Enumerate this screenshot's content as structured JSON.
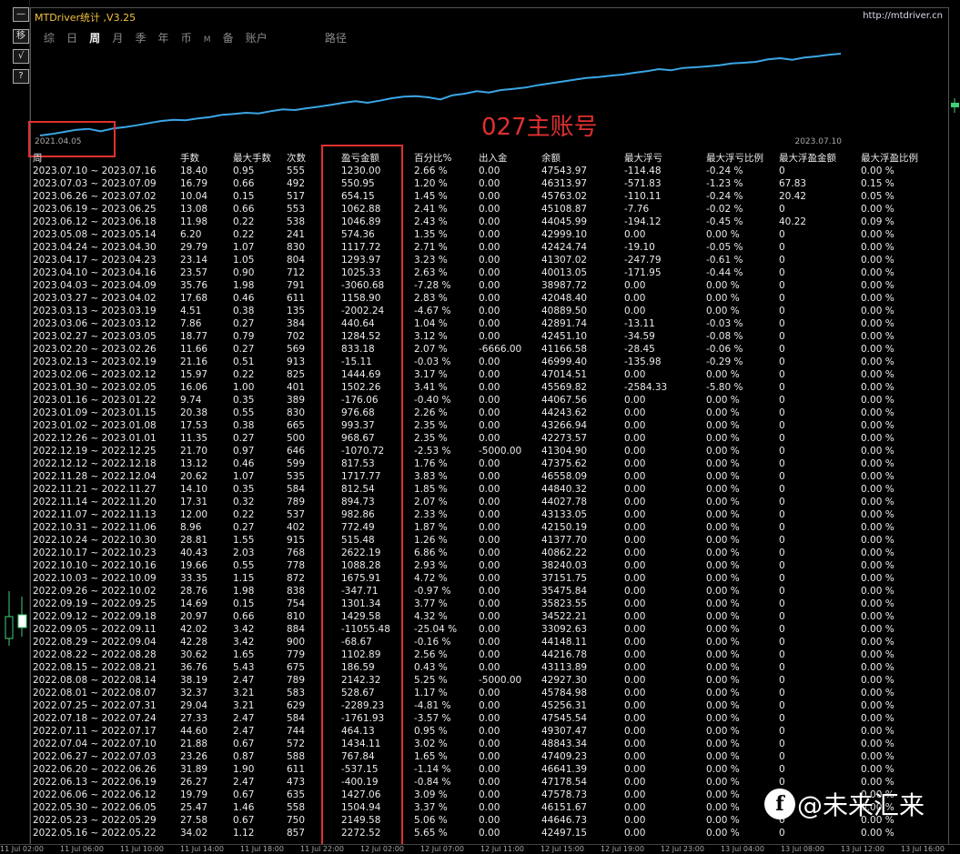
{
  "app": {
    "title": "MTDriver统计 ,V3.25",
    "site": "http://mtdriver.cn"
  },
  "toolbar": {
    "items": [
      {
        "icon": "minimize-icon",
        "label": "—"
      },
      {
        "icon": "copy-icon",
        "label": "移"
      },
      {
        "icon": "check-icon",
        "label": "√"
      },
      {
        "icon": "help-icon",
        "label": "?"
      }
    ]
  },
  "tabs": [
    {
      "label": "综",
      "active": false
    },
    {
      "label": "日",
      "active": false
    },
    {
      "label": "周",
      "active": true
    },
    {
      "label": "月",
      "active": false
    },
    {
      "label": "季",
      "active": false
    },
    {
      "label": "年",
      "active": false
    },
    {
      "label": "币",
      "active": false
    },
    {
      "label": "M",
      "active": false
    },
    {
      "label": "备",
      "active": false
    },
    {
      "label": "账户",
      "active": false
    },
    {
      "label": "路径",
      "active": false
    }
  ],
  "chart": {
    "start_date": "2021.04.05",
    "end_date": "2023.07.10",
    "line_color": "#3ba6e6",
    "balance_curve": [
      30000,
      30500,
      31200,
      31900,
      32200,
      31400,
      32300,
      32800,
      33400,
      34100,
      34800,
      35200,
      35000,
      35600,
      36100,
      36800,
      37100,
      37500,
      37300,
      38000,
      38600,
      38400,
      39000,
      39500,
      40100,
      40800,
      41300,
      40800,
      41500,
      42300,
      42800,
      43000,
      42600,
      41900,
      43300,
      43800,
      44600,
      44200,
      45000,
      45400,
      45800,
      46600,
      47200,
      47800,
      48400,
      49000,
      49300,
      49700,
      50100,
      50700,
      51200,
      51900,
      51500,
      52300,
      52500,
      52800,
      53200,
      53800,
      54000,
      54300,
      55100,
      55500,
      55000,
      55700,
      56100,
      56600,
      57000
    ]
  },
  "overlay_label": "027主账号",
  "columns": [
    "周",
    "手数",
    "最大手数",
    "次数",
    "盈亏金额",
    "百分比%",
    "出入金",
    "余额",
    "最大浮亏",
    "最大浮亏比例",
    "最大浮盈金额",
    "最大浮盈比例"
  ],
  "rows": [
    [
      "2023.07.10 ~ 2023.07.16",
      "18.40",
      "0.95",
      "555",
      "1230.00",
      "2.66 %",
      "0.00",
      "47543.97",
      "-114.48",
      "-0.24 %",
      "0",
      "0.00 %"
    ],
    [
      "2023.07.03 ~ 2023.07.09",
      "16.79",
      "0.66",
      "492",
      "550.95",
      "1.20 %",
      "0.00",
      "46313.97",
      "-571.83",
      "-1.23 %",
      "67.83",
      "0.15 %"
    ],
    [
      "2023.06.26 ~ 2023.07.02",
      "10.04",
      "0.15",
      "517",
      "654.15",
      "1.45 %",
      "0.00",
      "45763.02",
      "-110.11",
      "-0.24 %",
      "20.42",
      "0.05 %"
    ],
    [
      "2023.06.19 ~ 2023.06.25",
      "13.08",
      "0.66",
      "553",
      "1062.88",
      "2.41 %",
      "0.00",
      "45108.87",
      "-7.76",
      "-0.02 %",
      "0",
      "0.00 %"
    ],
    [
      "2023.06.12 ~ 2023.06.18",
      "11.98",
      "0.22",
      "538",
      "1046.89",
      "2.43 %",
      "0.00",
      "44045.99",
      "-194.12",
      "-0.45 %",
      "40.22",
      "0.09 %"
    ],
    [
      "2023.05.08 ~ 2023.05.14",
      "6.20",
      "0.22",
      "241",
      "574.36",
      "1.35 %",
      "0.00",
      "42999.10",
      "0.00",
      "0.00 %",
      "0",
      "0.00 %"
    ],
    [
      "2023.04.24 ~ 2023.04.30",
      "29.79",
      "1.07",
      "830",
      "1117.72",
      "2.71 %",
      "0.00",
      "42424.74",
      "-19.10",
      "-0.05 %",
      "0",
      "0.00 %"
    ],
    [
      "2023.04.17 ~ 2023.04.23",
      "23.14",
      "1.05",
      "804",
      "1293.97",
      "3.23 %",
      "0.00",
      "41307.02",
      "-247.79",
      "-0.61 %",
      "0",
      "0.00 %"
    ],
    [
      "2023.04.10 ~ 2023.04.16",
      "23.57",
      "0.90",
      "712",
      "1025.33",
      "2.63 %",
      "0.00",
      "40013.05",
      "-171.95",
      "-0.44 %",
      "0",
      "0.00 %"
    ],
    [
      "2023.04.03 ~ 2023.04.09",
      "35.76",
      "1.98",
      "791",
      "-3060.68",
      "-7.28 %",
      "0.00",
      "38987.72",
      "0.00",
      "0.00 %",
      "0",
      "0.00 %"
    ],
    [
      "2023.03.27 ~ 2023.04.02",
      "17.68",
      "0.46",
      "611",
      "1158.90",
      "2.83 %",
      "0.00",
      "42048.40",
      "0.00",
      "0.00 %",
      "0",
      "0.00 %"
    ],
    [
      "2023.03.13 ~ 2023.03.19",
      "4.51",
      "0.38",
      "135",
      "-2002.24",
      "-4.67 %",
      "0.00",
      "40889.50",
      "0.00",
      "0.00 %",
      "0",
      "0.00 %"
    ],
    [
      "2023.03.06 ~ 2023.03.12",
      "7.86",
      "0.27",
      "384",
      "440.64",
      "1.04 %",
      "0.00",
      "42891.74",
      "-13.11",
      "-0.03 %",
      "0",
      "0.00 %"
    ],
    [
      "2023.02.27 ~ 2023.03.05",
      "18.77",
      "0.79",
      "702",
      "1284.52",
      "3.12 %",
      "0.00",
      "42451.10",
      "-34.59",
      "-0.08 %",
      "0",
      "0.00 %"
    ],
    [
      "2023.02.20 ~ 2023.02.26",
      "11.66",
      "0.27",
      "569",
      "833.18",
      "2.07 %",
      "-6666.00",
      "41166.58",
      "-28.45",
      "-0.06 %",
      "0",
      "0.00 %"
    ],
    [
      "2023.02.13 ~ 2023.02.19",
      "21.16",
      "0.51",
      "913",
      "-15.11",
      "-0.03 %",
      "0.00",
      "46999.40",
      "-135.98",
      "-0.29 %",
      "0",
      "0.00 %"
    ],
    [
      "2023.02.06 ~ 2023.02.12",
      "15.97",
      "0.22",
      "825",
      "1444.69",
      "3.17 %",
      "0.00",
      "47014.51",
      "0.00",
      "0.00 %",
      "0",
      "0.00 %"
    ],
    [
      "2023.01.30 ~ 2023.02.05",
      "16.06",
      "1.00",
      "401",
      "1502.26",
      "3.41 %",
      "0.00",
      "45569.82",
      "-2584.33",
      "-5.80 %",
      "0",
      "0.00 %"
    ],
    [
      "2023.01.16 ~ 2023.01.22",
      "9.74",
      "0.35",
      "389",
      "-176.06",
      "-0.40 %",
      "0.00",
      "44067.56",
      "0.00",
      "0.00 %",
      "0",
      "0.00 %"
    ],
    [
      "2023.01.09 ~ 2023.01.15",
      "20.38",
      "0.55",
      "830",
      "976.68",
      "2.26 %",
      "0.00",
      "44243.62",
      "0.00",
      "0.00 %",
      "0",
      "0.00 %"
    ],
    [
      "2023.01.02 ~ 2023.01.08",
      "17.53",
      "0.38",
      "665",
      "993.37",
      "2.35 %",
      "0.00",
      "43266.94",
      "0.00",
      "0.00 %",
      "0",
      "0.00 %"
    ],
    [
      "2022.12.26 ~ 2023.01.01",
      "11.35",
      "0.27",
      "500",
      "968.67",
      "2.35 %",
      "0.00",
      "42273.57",
      "0.00",
      "0.00 %",
      "0",
      "0.00 %"
    ],
    [
      "2022.12.19 ~ 2022.12.25",
      "21.70",
      "0.97",
      "646",
      "-1070.72",
      "-2.53 %",
      "-5000.00",
      "41304.90",
      "0.00",
      "0.00 %",
      "0",
      "0.00 %"
    ],
    [
      "2022.12.12 ~ 2022.12.18",
      "13.12",
      "0.46",
      "599",
      "817.53",
      "1.76 %",
      "0.00",
      "47375.62",
      "0.00",
      "0.00 %",
      "0",
      "0.00 %"
    ],
    [
      "2022.11.28 ~ 2022.12.04",
      "20.62",
      "1.07",
      "535",
      "1717.77",
      "3.83 %",
      "0.00",
      "46558.09",
      "0.00",
      "0.00 %",
      "0",
      "0.00 %"
    ],
    [
      "2022.11.21 ~ 2022.11.27",
      "14.10",
      "0.35",
      "584",
      "812.54",
      "1.85 %",
      "0.00",
      "44840.32",
      "0.00",
      "0.00 %",
      "0",
      "0.00 %"
    ],
    [
      "2022.11.14 ~ 2022.11.20",
      "17.31",
      "0.32",
      "789",
      "894.73",
      "2.07 %",
      "0.00",
      "44027.78",
      "0.00",
      "0.00 %",
      "0",
      "0.00 %"
    ],
    [
      "2022.11.07 ~ 2022.11.13",
      "12.00",
      "0.22",
      "537",
      "982.86",
      "2.33 %",
      "0.00",
      "43133.05",
      "0.00",
      "0.00 %",
      "0",
      "0.00 %"
    ],
    [
      "2022.10.31 ~ 2022.11.06",
      "8.96",
      "0.27",
      "402",
      "772.49",
      "1.87 %",
      "0.00",
      "42150.19",
      "0.00",
      "0.00 %",
      "0",
      "0.00 %"
    ],
    [
      "2022.10.24 ~ 2022.10.30",
      "28.81",
      "1.55",
      "915",
      "515.48",
      "1.26 %",
      "0.00",
      "41377.70",
      "0.00",
      "0.00 %",
      "0",
      "0.00 %"
    ],
    [
      "2022.10.17 ~ 2022.10.23",
      "40.43",
      "2.03",
      "768",
      "2622.19",
      "6.86 %",
      "0.00",
      "40862.22",
      "0.00",
      "0.00 %",
      "0",
      "0.00 %"
    ],
    [
      "2022.10.10 ~ 2022.10.16",
      "19.66",
      "0.55",
      "778",
      "1088.28",
      "2.93 %",
      "0.00",
      "38240.03",
      "0.00",
      "0.00 %",
      "0",
      "0.00 %"
    ],
    [
      "2022.10.03 ~ 2022.10.09",
      "33.35",
      "1.15",
      "872",
      "1675.91",
      "4.72 %",
      "0.00",
      "37151.75",
      "0.00",
      "0.00 %",
      "0",
      "0.00 %"
    ],
    [
      "2022.09.26 ~ 2022.10.02",
      "28.76",
      "1.98",
      "838",
      "-347.71",
      "-0.97 %",
      "0.00",
      "35475.84",
      "0.00",
      "0.00 %",
      "0",
      "0.00 %"
    ],
    [
      "2022.09.19 ~ 2022.09.25",
      "14.69",
      "0.15",
      "754",
      "1301.34",
      "3.77 %",
      "0.00",
      "35823.55",
      "0.00",
      "0.00 %",
      "0",
      "0.00 %"
    ],
    [
      "2022.09.12 ~ 2022.09.18",
      "20.97",
      "0.66",
      "810",
      "1429.58",
      "4.32 %",
      "0.00",
      "34522.21",
      "0.00",
      "0.00 %",
      "0",
      "0.00 %"
    ],
    [
      "2022.09.05 ~ 2022.09.11",
      "42.02",
      "3.42",
      "884",
      "-11055.48",
      "-25.04 %",
      "0.00",
      "33092.63",
      "0.00",
      "0.00 %",
      "0",
      "0.00 %"
    ],
    [
      "2022.08.29 ~ 2022.09.04",
      "42.28",
      "3.42",
      "900",
      "-68.67",
      "-0.16 %",
      "0.00",
      "44148.11",
      "0.00",
      "0.00 %",
      "0",
      "0.00 %"
    ],
    [
      "2022.08.22 ~ 2022.08.28",
      "30.62",
      "1.65",
      "779",
      "1102.89",
      "2.56 %",
      "0.00",
      "44216.78",
      "0.00",
      "0.00 %",
      "0",
      "0.00 %"
    ],
    [
      "2022.08.15 ~ 2022.08.21",
      "36.76",
      "5.43",
      "675",
      "186.59",
      "0.43 %",
      "0.00",
      "43113.89",
      "0.00",
      "0.00 %",
      "0",
      "0.00 %"
    ],
    [
      "2022.08.08 ~ 2022.08.14",
      "38.19",
      "2.47",
      "789",
      "2142.32",
      "5.25 %",
      "-5000.00",
      "42927.30",
      "0.00",
      "0.00 %",
      "0",
      "0.00 %"
    ],
    [
      "2022.08.01 ~ 2022.08.07",
      "32.37",
      "3.21",
      "583",
      "528.67",
      "1.17 %",
      "0.00",
      "45784.98",
      "0.00",
      "0.00 %",
      "0",
      "0.00 %"
    ],
    [
      "2022.07.25 ~ 2022.07.31",
      "29.04",
      "3.21",
      "629",
      "-2289.23",
      "-4.81 %",
      "0.00",
      "45256.31",
      "0.00",
      "0.00 %",
      "0",
      "0.00 %"
    ],
    [
      "2022.07.18 ~ 2022.07.24",
      "27.33",
      "2.47",
      "584",
      "-1761.93",
      "-3.57 %",
      "0.00",
      "47545.54",
      "0.00",
      "0.00 %",
      "0",
      "0.00 %"
    ],
    [
      "2022.07.11 ~ 2022.07.17",
      "44.60",
      "2.47",
      "744",
      "464.13",
      "0.95 %",
      "0.00",
      "49307.47",
      "0.00",
      "0.00 %",
      "0",
      "0.00 %"
    ],
    [
      "2022.07.04 ~ 2022.07.10",
      "21.88",
      "0.67",
      "572",
      "1434.11",
      "3.02 %",
      "0.00",
      "48843.34",
      "0.00",
      "0.00 %",
      "0",
      "0.00 %"
    ],
    [
      "2022.06.27 ~ 2022.07.03",
      "23.26",
      "0.87",
      "588",
      "767.84",
      "1.65 %",
      "0.00",
      "47409.23",
      "0.00",
      "0.00 %",
      "0",
      "0.00 %"
    ],
    [
      "2022.06.20 ~ 2022.06.26",
      "31.89",
      "1.90",
      "611",
      "-537.15",
      "-1.14 %",
      "0.00",
      "46641.39",
      "0.00",
      "0.00 %",
      "0",
      "0.00 %"
    ],
    [
      "2022.06.13 ~ 2022.06.19",
      "26.27",
      "2.47",
      "473",
      "-400.19",
      "-0.84 %",
      "0.00",
      "47178.54",
      "0.00",
      "0.00 %",
      "0",
      "0.00 %"
    ],
    [
      "2022.06.06 ~ 2022.06.12",
      "19.79",
      "0.67",
      "635",
      "1427.06",
      "3.09 %",
      "0.00",
      "47578.73",
      "0.00",
      "0.00 %",
      "0",
      "0.00 %"
    ],
    [
      "2022.05.30 ~ 2022.06.05",
      "25.47",
      "1.46",
      "558",
      "1504.94",
      "3.37 %",
      "0.00",
      "46151.67",
      "0.00",
      "0.00 %",
      "0",
      "0.00 %"
    ],
    [
      "2022.05.23 ~ 2022.05.29",
      "27.58",
      "0.67",
      "750",
      "2149.58",
      "5.06 %",
      "0.00",
      "44646.73",
      "0.00",
      "0.00 %",
      "0",
      "0.00 %"
    ],
    [
      "2022.05.16 ~ 2022.05.22",
      "34.02",
      "1.12",
      "857",
      "2272.52",
      "5.65 %",
      "0.00",
      "42497.15",
      "0.00",
      "0.00 %",
      "0",
      "0.00 %"
    ]
  ],
  "watermark": {
    "text": "@未来汇来"
  },
  "bottom_axis": [
    "11 Jul 02:00",
    "11 Jul 06:00",
    "11 Jul 10:00",
    "11 Jul 14:00",
    "11 Jul 18:00",
    "11 Jul 22:00",
    "12 Jul 02:00",
    "12 Jul 07:00",
    "12 Jul 11:00",
    "12 Jul 15:00",
    "12 Jul 19:00",
    "12 Jul 23:00",
    "13 Jul 04:00",
    "13 Jul 08:00",
    "13 Jul 12:00",
    "13 Jul 16:00",
    "13 Jul 20:00"
  ]
}
